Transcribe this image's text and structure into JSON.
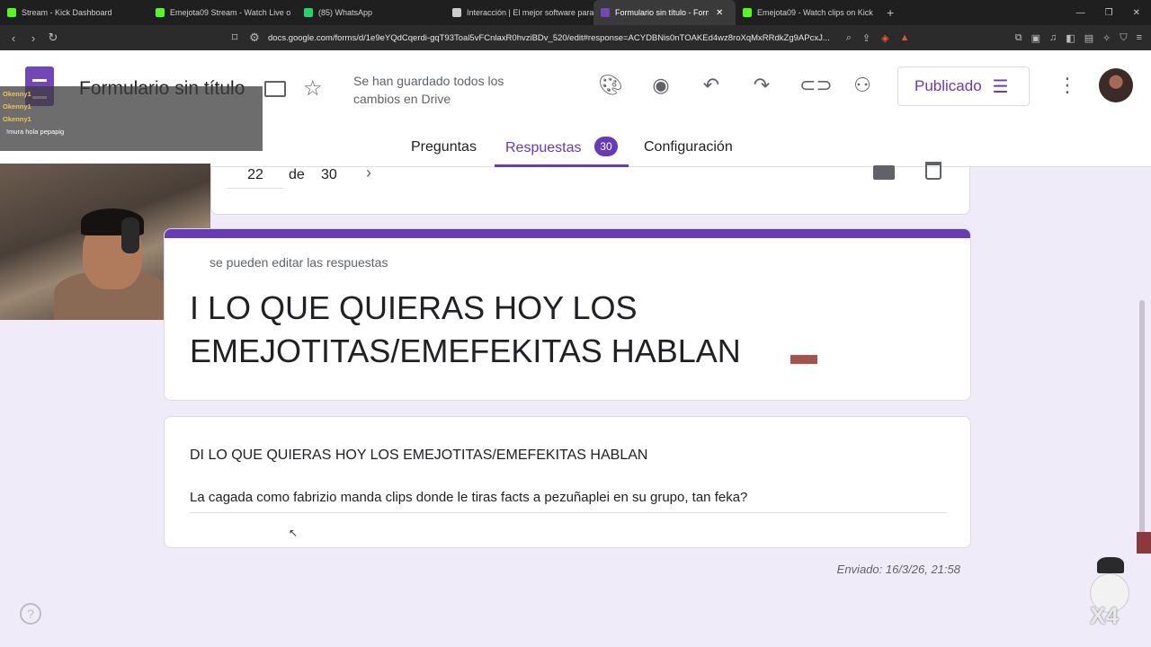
{
  "browser": {
    "tabs": [
      {
        "label": "Stream - Kick Dashboard",
        "favicon": "K",
        "color": "#53fc18"
      },
      {
        "label": "Emejota09 Stream - Watch Live o",
        "favicon": "K",
        "color": "#53fc18"
      },
      {
        "label": "(85) WhatsApp",
        "favicon": "85",
        "color": "#25d366"
      },
      {
        "label": "Interacción | El mejor software para p",
        "favicon": "◆",
        "color": "#cccccc"
      },
      {
        "label": "Formulario sin título - Formulario",
        "favicon": "≡",
        "color": "#7248b9"
      },
      {
        "label": "Emejota09 - Watch clips on Kick",
        "favicon": "K",
        "color": "#53fc18"
      }
    ],
    "url": "docs.google.com/forms/d/1e9eYQdCqerdi-gqT93Toal5vFCnlaxR0hvziBDv_520/edit#response=ACYDBNis0nTOAKEd4wz8roXqMxRRdkZg9APcxJ..."
  },
  "header": {
    "doc_title": "Formulario sin título",
    "saved_message": "Se han guardado todos los cambios en Drive",
    "publish_label": "Publicado",
    "tabs": {
      "questions": "Preguntas",
      "responses": "Respuestas",
      "responses_count": "30",
      "settings": "Configuración"
    }
  },
  "chat": [
    {
      "user": "Okenny1",
      "msg": ""
    },
    {
      "user": "Okenny1",
      "msg": ""
    },
    {
      "user": "Okenny1",
      "msg": ""
    },
    {
      "user": "",
      "msg": "!mura hola pepapig"
    },
    {
      "user": "",
      "msg": ""
    }
  ],
  "response_nav": {
    "current": "22",
    "separator": "de",
    "total": "30"
  },
  "form": {
    "edit_note": "se pueden editar las respuestas",
    "title": "I LO QUE QUIERAS HOY LOS EMEJOTITAS/EMEFEKITAS HABLAN",
    "question": "DI LO QUE QUIERAS HOY LOS EMEJOTITAS/EMEFEKITAS HABLAN",
    "answer": "La cagada como fabrizio manda clips donde le tiras facts a pezuñaplei en su grupo, tan feka?",
    "submitted": "Enviado: 16/3/26, 21:58"
  },
  "overlay": {
    "mascot_text": "X4"
  },
  "colors": {
    "accent": "#673ab7",
    "background": "#f0ebf8"
  }
}
